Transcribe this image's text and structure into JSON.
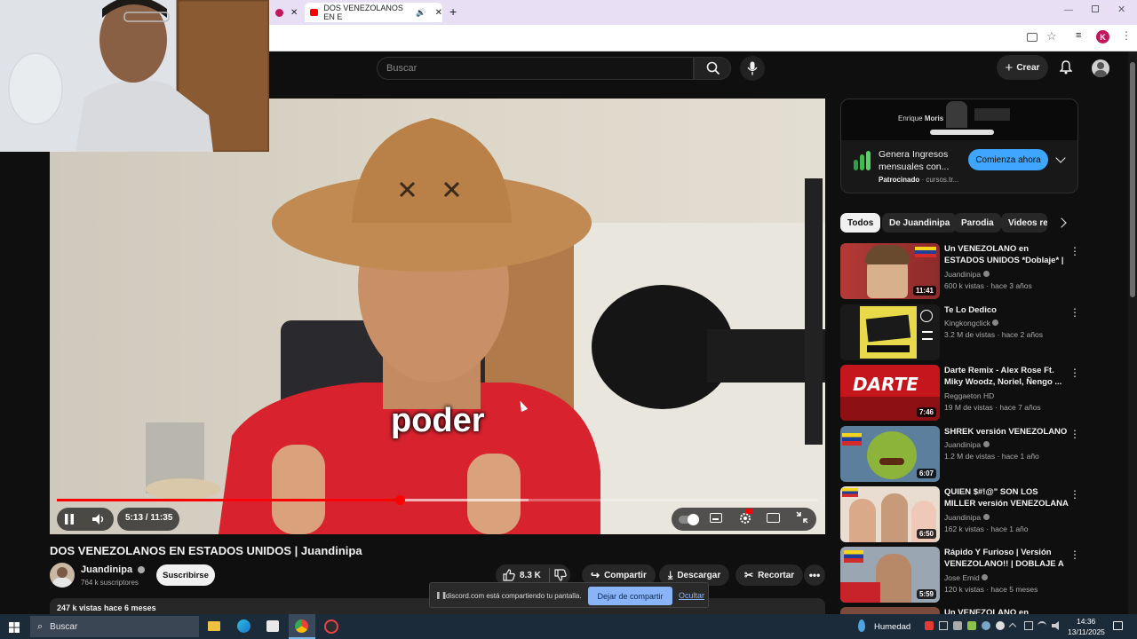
{
  "browser": {
    "tab_title": "DOS VENEZOLANOS EN E",
    "new_tab": "+",
    "window_controls": [
      "minimize",
      "restore",
      "close"
    ],
    "profile_initial": "K",
    "colors": {
      "tabbar": "#e8dff5",
      "accent": "#c2185b"
    }
  },
  "header": {
    "search_placeholder": "Buscar",
    "create_label": "Crear"
  },
  "player": {
    "subtitle": "poder",
    "time": "5:13 / 11:35",
    "progress": 0.45,
    "buffered": 0.62
  },
  "video": {
    "title": "DOS VENEZOLANOS EN ESTADOS UNIDOS | Juandinipa",
    "channel": "Juandinipa",
    "subscribers": "764 k suscriptores",
    "subscribe_label": "Suscribirse",
    "likes": "8.3 K",
    "share_label": "Compartir",
    "download_label": "Descargar",
    "clip_label": "Recortar",
    "views_line": "247 k vistas  hace 6 meses"
  },
  "share_banner": {
    "message": "discord.com está compartiendo tu pantalla.",
    "stop_label": "Dejar de compartir",
    "hide_label": "Ocultar"
  },
  "ad": {
    "banner_name": "Enrique",
    "banner_name_bold": "Moris",
    "headline": "Genera Ingresos mensuales con...",
    "sponsored": "Patrocinado",
    "domain": "· cursos.tr...",
    "cta": "Comienza ahora"
  },
  "chips": [
    "Todos",
    "De Juandinipa",
    "Parodia",
    "Videos rel"
  ],
  "recommendations": [
    {
      "title": "Un VENEZOLANO en ESTADOS UNIDOS *Doblaje* | Juandinipa",
      "channel": "Juandinipa",
      "meta": "600 k vistas · hace 3 años",
      "duration": "11:41",
      "verified": true
    },
    {
      "title": "Te Lo Dedico",
      "channel": "Kingkongclick",
      "meta": "3.2 M de vistas · hace 2 años",
      "duration": "",
      "verified": true
    },
    {
      "title": "Darte Remix - Alex Rose Ft. Miky Woodz, Noriel, Ñengo ...",
      "channel": "Reggaeton HD",
      "meta": "19 M de vistas · hace 7 años",
      "duration": "7:46",
      "verified": false
    },
    {
      "title": "SHREK versión VENEZOLANO",
      "channel": "Juandinipa",
      "meta": "1.2 M de vistas · hace 1 año",
      "duration": "6:07",
      "verified": true
    },
    {
      "title": "QUIEN $#!@\" SON LOS MILLER versión VENEZOLANA | ...",
      "channel": "Juandinipa",
      "meta": "162 k vistas · hace 1 año",
      "duration": "6:50",
      "verified": true
    },
    {
      "title": "Rápido Y Furioso | Versión VENEZOLANO!! | DOBLAJE A L...",
      "channel": "Jose Emid",
      "meta": "120 k vistas · hace 5 meses",
      "duration": "5:59",
      "verified": true
    },
    {
      "title": "Un VENEZOLANO en ESTADOS",
      "channel": "",
      "meta": "",
      "duration": "",
      "verified": false
    }
  ],
  "taskbar": {
    "search_placeholder": "Buscar",
    "weather": "Humedad",
    "time": "14:36",
    "date": "13/11/2025"
  }
}
